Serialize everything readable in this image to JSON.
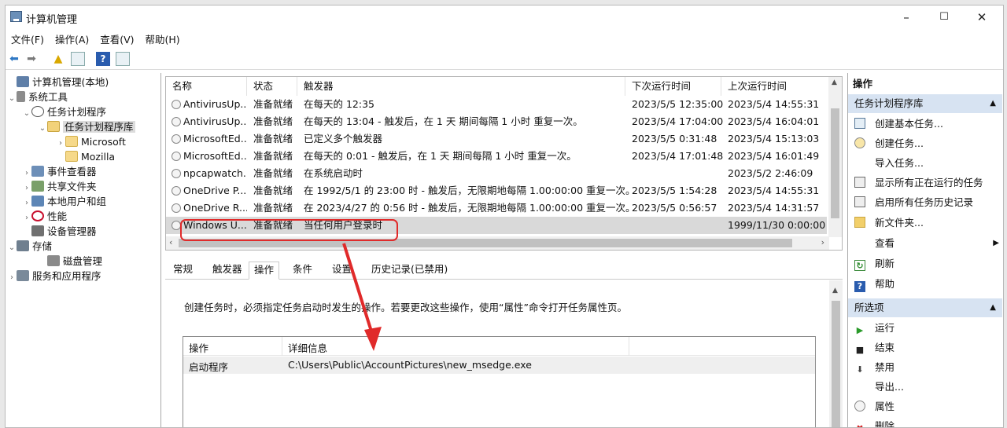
{
  "window": {
    "title": "计算机管理"
  },
  "menu": [
    "文件(F)",
    "操作(A)",
    "查看(V)",
    "帮助(H)"
  ],
  "toolbar_icons": [
    "back-icon",
    "forward-icon",
    "folder-up-icon",
    "show-hide-tree-icon",
    "help-icon",
    "properties-icon"
  ],
  "tree": [
    {
      "label": "计算机管理(本地)",
      "icon": "computer-icon"
    },
    {
      "label": "系统工具",
      "icon": "tools-icon"
    },
    {
      "label": "任务计划程序",
      "icon": "clock-icon"
    },
    {
      "label": "任务计划程序库",
      "icon": "folder-clock-icon"
    },
    {
      "label": "Microsoft",
      "icon": "folder-icon"
    },
    {
      "label": "Mozilla",
      "icon": "folder-icon"
    },
    {
      "label": "事件查看器",
      "icon": "event-viewer-icon"
    },
    {
      "label": "共享文件夹",
      "icon": "shared-folder-icon"
    },
    {
      "label": "本地用户和组",
      "icon": "users-icon"
    },
    {
      "label": "性能",
      "icon": "performance-icon"
    },
    {
      "label": "设备管理器",
      "icon": "device-manager-icon"
    },
    {
      "label": "存储",
      "icon": "storage-icon"
    },
    {
      "label": "磁盘管理",
      "icon": "disk-icon"
    },
    {
      "label": "服务和应用程序",
      "icon": "services-icon"
    }
  ],
  "task_table": {
    "columns": [
      "名称",
      "状态",
      "触发器",
      "下次运行时间",
      "上次运行时间"
    ],
    "rows": [
      {
        "name": "AntivirusUp...",
        "status": "准备就绪",
        "trigger": "在每天的 12:35",
        "next": "2023/5/5 12:35:00",
        "last": "2023/5/4 14:55:31"
      },
      {
        "name": "AntivirusUp...",
        "status": "准备就绪",
        "trigger": "在每天的 13:04 - 触发后，在 1 天 期间每隔 1 小时 重复一次。",
        "next": "2023/5/4 17:04:00",
        "last": "2023/5/4 16:04:01"
      },
      {
        "name": "MicrosoftEd...",
        "status": "准备就绪",
        "trigger": "已定义多个触发器",
        "next": "2023/5/5 0:31:48",
        "last": "2023/5/4 15:13:03"
      },
      {
        "name": "MicrosoftEd...",
        "status": "准备就绪",
        "trigger": "在每天的 0:01 - 触发后，在 1 天 期间每隔 1 小时 重复一次。",
        "next": "2023/5/4 17:01:48",
        "last": "2023/5/4 16:01:49"
      },
      {
        "name": "npcapwatch...",
        "status": "准备就绪",
        "trigger": "在系统启动时",
        "next": "",
        "last": "2023/5/2 2:46:09"
      },
      {
        "name": "OneDrive P...",
        "status": "准备就绪",
        "trigger": "在 1992/5/1 的 23:00 时 - 触发后，无限期地每隔 1.00:00:00 重复一次。",
        "next": "2023/5/5 1:54:28",
        "last": "2023/5/4 14:55:31"
      },
      {
        "name": "OneDrive R...",
        "status": "准备就绪",
        "trigger": "在 2023/4/27 的 0:56 时 - 触发后，无限期地每隔 1.00:00:00 重复一次。",
        "next": "2023/5/5 0:56:57",
        "last": "2023/5/4 14:31:57"
      },
      {
        "name": "Windows U...",
        "status": "准备就绪",
        "trigger": "当任何用户登录时",
        "next": "",
        "last": "1999/11/30 0:00:00"
      }
    ]
  },
  "detail_tabs": [
    "常规",
    "触发器",
    "操作",
    "条件",
    "设置",
    "历史记录(已禁用)"
  ],
  "detail": {
    "description": "创建任务时，必须指定任务启动时发生的操作。若要更改这些操作，使用“属性”命令打开任务属性页。",
    "columns": [
      "操作",
      "详细信息"
    ],
    "rows": [
      {
        "action": "启动程序",
        "details": "C:\\Users\\Public\\AccountPictures\\new_msedge.exe"
      }
    ]
  },
  "actions_pane": {
    "header": "操作",
    "section1": "任务计划程序库",
    "items1": [
      {
        "label": "创建基本任务...",
        "icon": "create-basic-task-icon"
      },
      {
        "label": "创建任务...",
        "icon": "create-task-icon"
      },
      {
        "label": "导入任务...",
        "icon": ""
      },
      {
        "label": "显示所有正在运行的任务",
        "icon": "running-tasks-icon"
      },
      {
        "label": "启用所有任务历史记录",
        "icon": "history-icon"
      },
      {
        "label": "新文件夹...",
        "icon": "new-folder-icon"
      },
      {
        "label": "查看",
        "icon": ""
      },
      {
        "label": "刷新",
        "icon": "refresh-icon"
      },
      {
        "label": "帮助",
        "icon": "help-icon"
      }
    ],
    "section2": "所选项",
    "items2": [
      {
        "label": "运行",
        "icon": "run-icon"
      },
      {
        "label": "结束",
        "icon": "end-icon"
      },
      {
        "label": "禁用",
        "icon": "disable-icon"
      },
      {
        "label": "导出...",
        "icon": ""
      },
      {
        "label": "属性",
        "icon": "properties-icon"
      },
      {
        "label": "删除",
        "icon": "delete-icon"
      }
    ]
  },
  "colors": {
    "highlight": "#e02a2a",
    "section_bg": "#d7e3f2",
    "selected_row": "#d9d9d9"
  }
}
